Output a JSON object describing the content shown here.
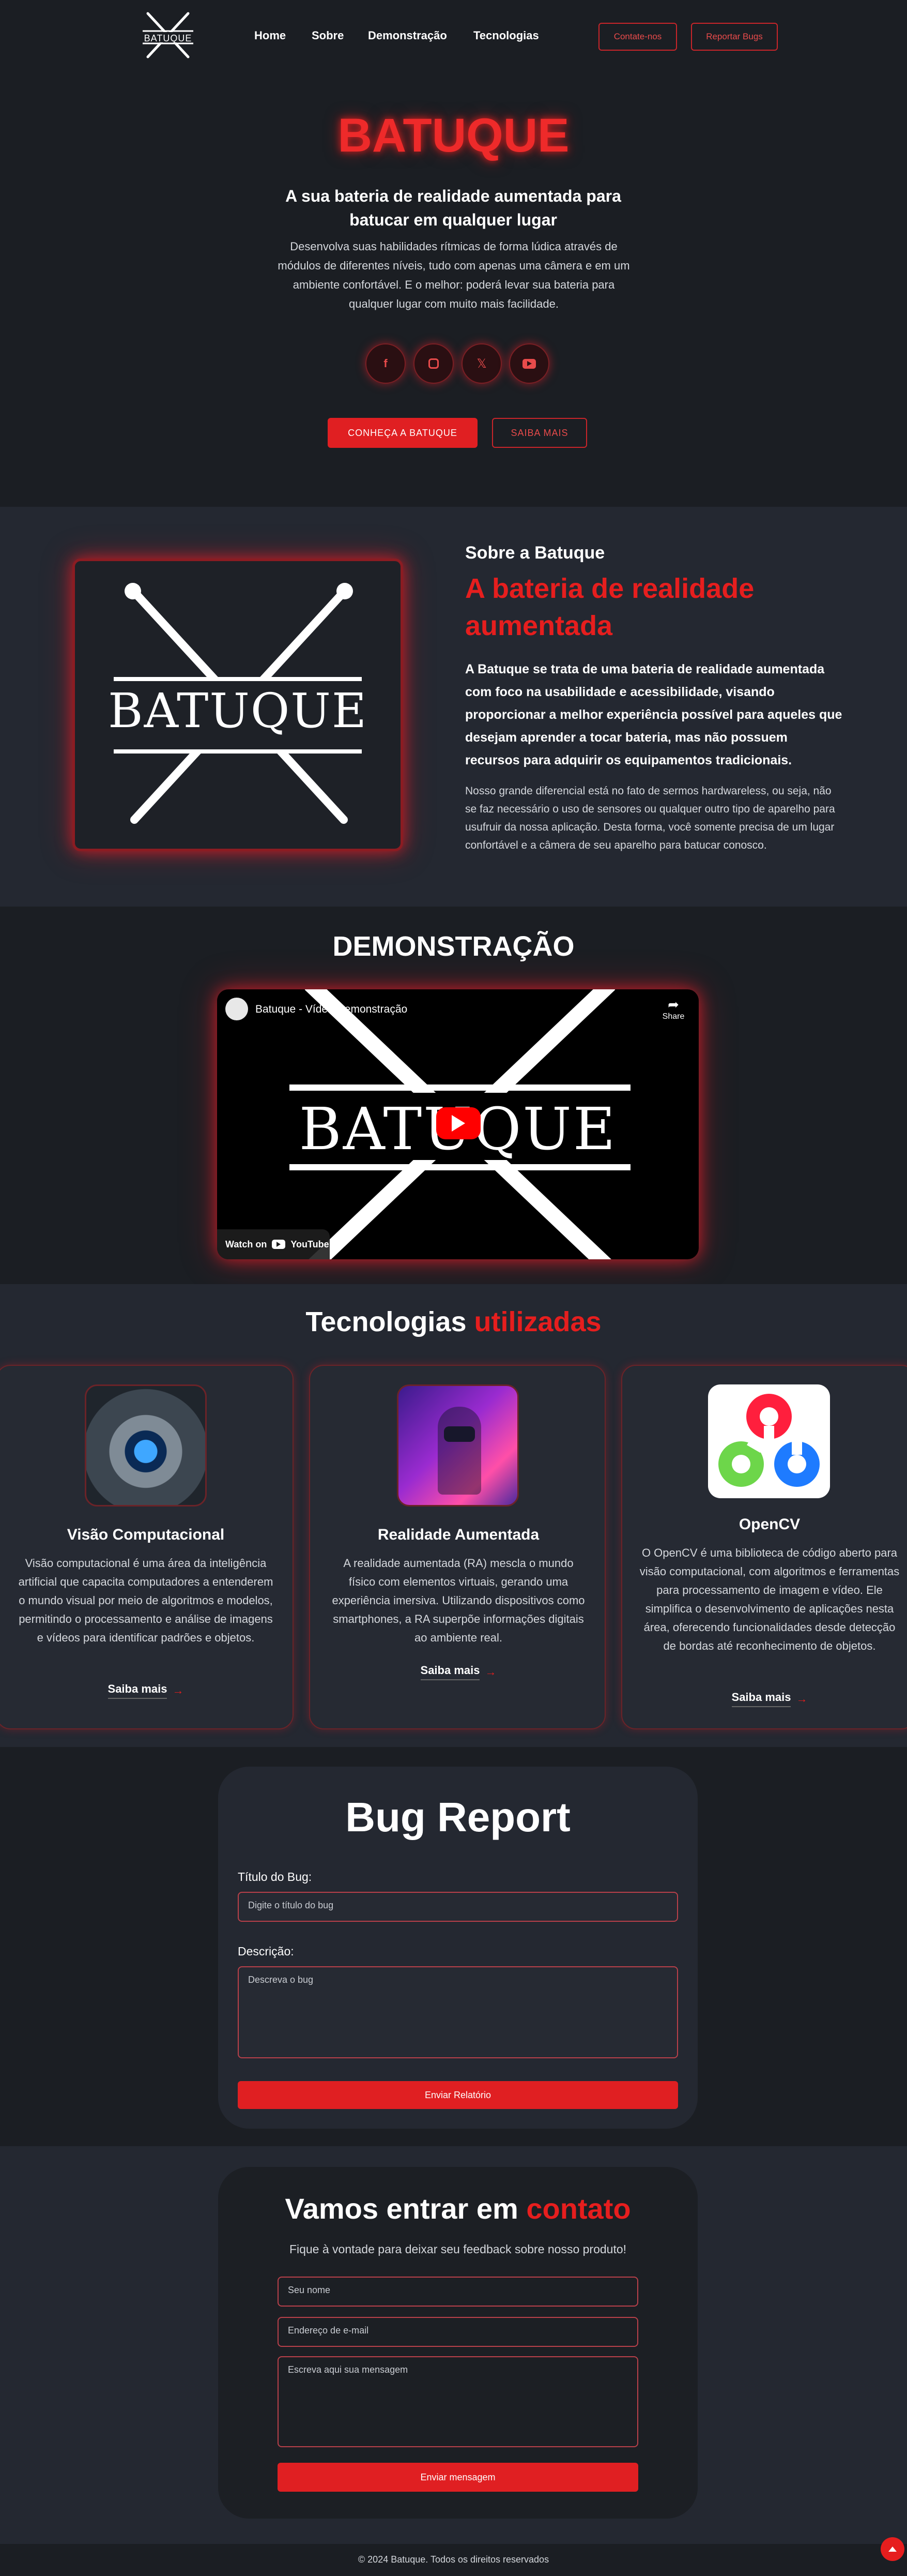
{
  "nav": {
    "logo_text": "BATUQUE",
    "links": [
      "Home",
      "Sobre",
      "Demonstração",
      "Tecnologias"
    ],
    "contact_button": "Contate-nos",
    "bug_button": "Reportar Bugs"
  },
  "hero": {
    "title": "BATUQUE",
    "subtitle": "A sua bateria de realidade aumentada para batucar em qualquer lugar",
    "description": "Desenvolva suas habilidades rítmicas de forma lúdica através de módulos de diferentes níveis, tudo com apenas uma câmera e em um ambiente confortável. E o melhor: poderá levar sua bateria para qualquer lugar com muito mais facilidade.",
    "social_icons": [
      "facebook-icon",
      "instagram-icon",
      "x-icon",
      "youtube-icon"
    ],
    "primary_button": "CONHEÇA A BATUQUE",
    "secondary_button": "SAIBA MAIS"
  },
  "about": {
    "logo_text": "BATUQUE",
    "eyebrow": "Sobre a Batuque",
    "heading": "A bateria de realidade aumentada",
    "paragraph1": "A Batuque se trata de uma bateria de realidade aumentada com foco na usabilidade e acessibilidade, visando proporcionar a melhor experiência possível para aqueles que desejam aprender a tocar bateria, mas não possuem recursos para adquirir os equipamentos tradicionais.",
    "paragraph2": "Nosso grande diferencial está no fato de sermos hardwareless, ou seja, não se faz necessário o uso de sensores ou qualquer outro tipo de aparelho para usufruir da nossa aplicação. Desta forma, você somente precisa de um lugar confortável e a câmera de seu aparelho para batucar conosco."
  },
  "demo": {
    "heading": "DEMONSTRAÇÃO",
    "video_title": "Batuque - Vídeo Demonstração",
    "share_label": "Share",
    "watch_on": "Watch on",
    "youtube_label": "YouTube",
    "logo_text": "BATUQUE"
  },
  "tech": {
    "heading_white": "Tecnologias",
    "heading_red": "utilizadas",
    "cards": [
      {
        "title": "Visão Computacional",
        "text": "Visão computacional é uma área da inteligência artificial que capacita computadores a entenderem o mundo visual por meio de algoritmos e modelos, permitindo o processamento e análise de imagens e vídeos para identificar padrões e objetos.",
        "link": "Saiba mais"
      },
      {
        "title": "Realidade Aumentada",
        "text": "A realidade aumentada (RA) mescla o mundo físico com elementos virtuais, gerando uma experiência imersiva. Utilizando dispositivos como smartphones, a RA superpõe informações digitais ao ambiente real.",
        "link": "Saiba mais"
      },
      {
        "title": "OpenCV",
        "text": "O OpenCV é uma biblioteca de código aberto para visão computacional, com algoritmos e ferramentas para processamento de imagem e vídeo. Ele simplifica o desenvolvimento de aplicações nesta área, oferecendo funcionalidades desde detecção de bordas até reconhecimento de objetos.",
        "link": "Saiba mais"
      }
    ]
  },
  "bug": {
    "heading": "Bug Report",
    "title_label": "Título do Bug:",
    "title_placeholder": "Digite o título do bug",
    "desc_label": "Descrição:",
    "desc_placeholder": "Descreva o bug",
    "submit": "Enviar Relatório"
  },
  "contact": {
    "heading_white": "Vamos entrar em",
    "heading_red": "contato",
    "subtitle": "Fique à vontade para deixar seu feedback sobre nosso produto!",
    "name_placeholder": "Seu nome",
    "email_placeholder": "Endereço de e-mail",
    "message_placeholder": "Escreva aqui sua mensagem",
    "submit": "Enviar mensagem"
  },
  "footer": {
    "copyright": "© 2024 Batuque. Todos os direitos reservados"
  },
  "colors": {
    "accent": "#e61e1e",
    "background": "#1b1e23",
    "section_alt": "#242831"
  }
}
